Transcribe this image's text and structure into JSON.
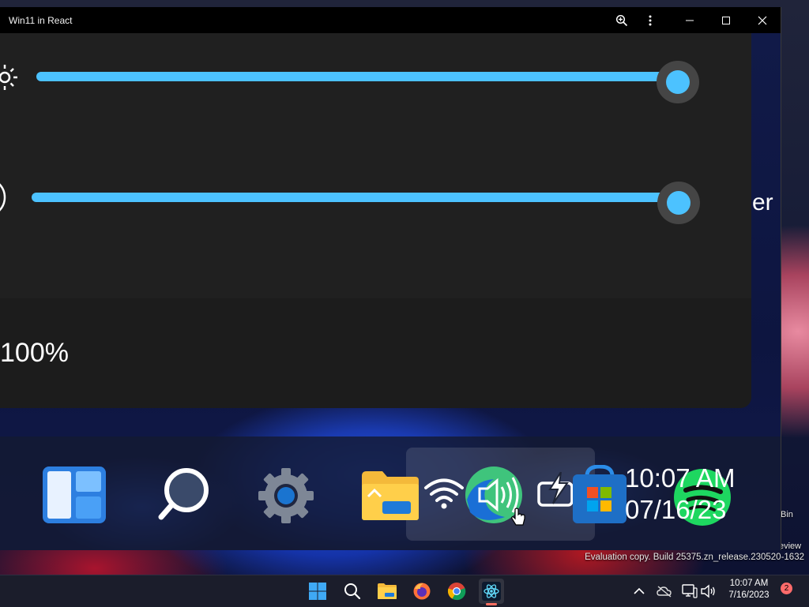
{
  "window": {
    "title": "Win11 in React",
    "controls": [
      "zoom-icon",
      "more-icon",
      "minimize-icon",
      "maximize-icon",
      "close-icon"
    ]
  },
  "quick_settings": {
    "brightness": {
      "icon": "brightness-icon",
      "value": 1.0
    },
    "volume": {
      "icon": "volume-icon",
      "value": 1.0
    },
    "clipped_label": "er",
    "battery_percent": "100%",
    "accent_color": "#4cc2ff"
  },
  "zoomed_taskbar": {
    "icons": [
      "widgets-icon",
      "search-icon",
      "settings-icon",
      "file-explorer-icon",
      "wifi-icon",
      "volume-icon",
      "battery-icon",
      "store-icon",
      "spotify-icon"
    ],
    "time": "10:07 AM",
    "date": "07/16/23"
  },
  "desktop": {
    "recycle_bin_label": "Bin",
    "preview_label": "eview",
    "watermark": "Evaluation copy. Build 25375.zn_release.230520-1632"
  },
  "taskbar": {
    "apps": [
      "start-icon",
      "search-icon",
      "file-explorer-icon",
      "firefox-icon",
      "chrome-icon",
      "win11-react-icon"
    ],
    "tray": [
      "chevron-up-icon",
      "onedrive-icon",
      "network-icon",
      "volume-icon"
    ],
    "time": "10:07 AM",
    "date": "7/16/2023",
    "notification_count": "2"
  }
}
